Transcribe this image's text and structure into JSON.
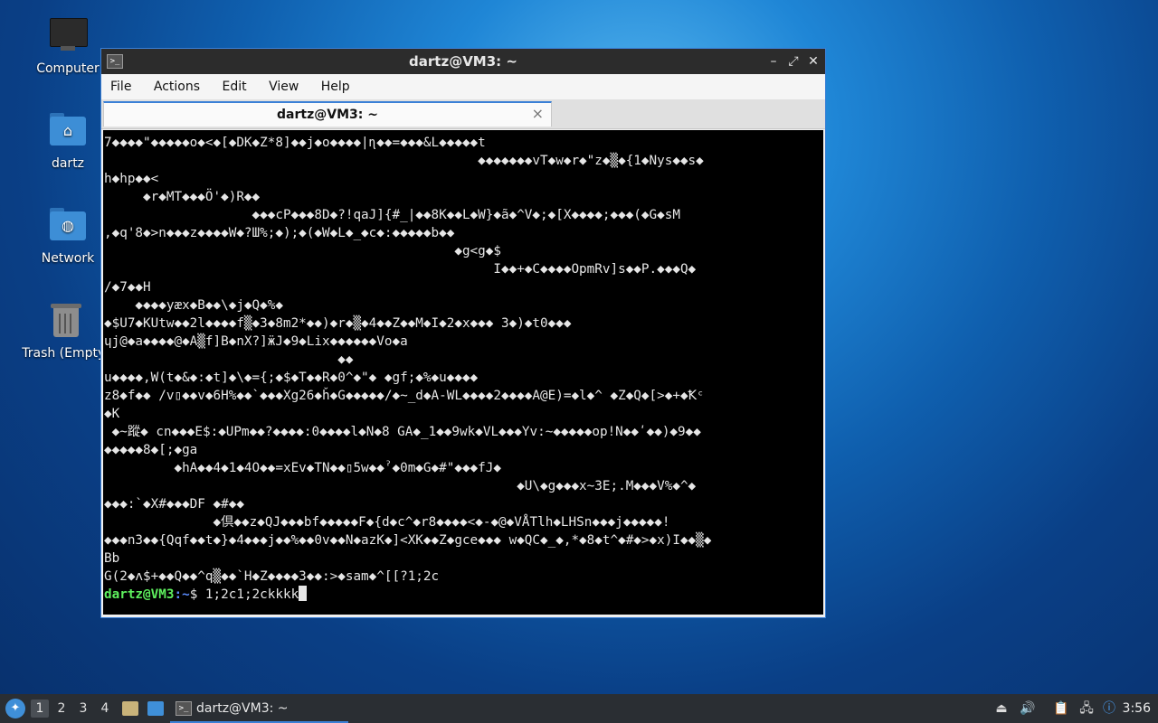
{
  "desktop": {
    "icons": [
      {
        "label": "Computer"
      },
      {
        "label": "dartz"
      },
      {
        "label": "Network"
      },
      {
        "label": "Trash (Empty)"
      }
    ]
  },
  "window": {
    "title": "dartz@VM3: ~",
    "buttons": {
      "minimize": "–",
      "maximize": "⤢",
      "close": "✕"
    },
    "menu": [
      "File",
      "Actions",
      "Edit",
      "View",
      "Help"
    ],
    "tab": {
      "label": "dartz@VM3: ~",
      "close": "×"
    }
  },
  "terminal": {
    "lines": [
      "7◆◆◆◆\"◆◆◆◆◆o◆<◆[◆DK◆Z*8]◆◆j◆o◆◆◆◆|ɳ◆◆=◆◆◆&L◆◆◆◆◆t",
      "                                                ◆◆◆◆◆◆◆vT◆w◆r◆\"z◆▒◆{1◆Nys◆◆s◆",
      "h◆hp◆◆<",
      "     ◆r◆MT◆◆◆Ö'◆)R◆◆",
      "                   ◆◆◆cP◆◆◆8D◆?!qaJ]{#_|◆◆8K◆◆L◆W}◆ã◆^V◆;◆[X◆◆◆◆;◆◆◆(◆G◆sM",
      ",◆q'8◆>n◆◆◆z◆◆◆◆W◆?Ш%;◆);◆(◆W◆L◆_◆c◆:◆◆◆◆◆b◆◆",
      "                                             ◆g<g◆$",
      "                                                  I◆◆+◆C◆◆◆◆OpmRv]s◆◆P.◆◆◆Q◆",
      "/◆7◆◆H",
      "    ◆◆◆◆yæx◆B◆◆\\◆j◆Q◆%◆",
      "◆$U7◆KUtw◆◆2l◆◆◆◆f▒◆3◆8m2*◆◆)◆r◆▒◆4◆◆Z◆◆M◆I◆2◆x◆◆◆ 3◆)◆t0◆◆◆",
      "ɥj@◆a◆◆◆◆@◆A▒f]B◆nX?]ӝJ◆9◆Lix◆◆◆◆◆◆Vo◆a",
      "                              ◆◆",
      "u◆◆◆◆,W(t◆&◆:◆t]◆\\◆={;◆$◆T◆◆R◆0^◆\"◆ ◆gf;◆%◆u◆◆◆◆",
      "z8◆f◆◆ /v▯◆◆v◆6H%◆◆`◆◆◆Xg26◆ȟ◆G◆◆◆◆◆/◆~_d◆A-WL◆◆◆◆2◆◆◆◆A@E)=◆l◆^ ◆Z◆Q◆[>◆+◆Ꝁᶜ",
      "◆K",
      " ◆~蹤◆ cn◆◆◆E$:◆UPm◆◆?◆◆◆◆:0◆◆◆◆l◆N◆8 GA◆_1◆◆9wk◆VL◆◆◆Yv:~◆◆◆◆◆op!N◆◆ʹ◆◆)◆9◆◆",
      "◆◆◆◆◆8◆[;◆ga",
      "         ◆hA◆◆4◆1◆4O◆◆=xEv◆TN◆◆▯5w◆◆ˀ◆0m◆G◆#\"◆◆◆fJ◆",
      "                                                     ◆U\\◆g◆◆◆x~3E;.M◆◆◆V%◆^◆",
      "◆◆◆:`◆X#◆◆◆DF ◆#◆◆",
      "              ◆倶◆◆z◆QJ◆◆◆bf◆◆◆◆◆F◆{d◆c^◆r8◆◆◆◆<◆-◆@◆VÅTlh◆LHSn◆◆◆j◆◆◆◆◆!",
      "◆◆◆n3◆◆{Qqf◆◆t◆}◆4◆◆◆j◆◆%◆◆0v◆◆N◆azK◆]<XK◆◆Z◆gce◆◆◆ w◆QC◆_◆,*◆8◆t^◆#◆>◆x)I◆◆▒◆",
      "Bb",
      "G(2◆ʌ$+◆◆Q◆◆^q▒◆◆`H◆Z◆◆◆◆3◆◆:>◆sam◆^[[?1;2c"
    ],
    "prompt_user": "dartz@VM3",
    "prompt_path": ":~",
    "prompt_symbol": "$ ",
    "command": "1;2c1;2ckkkk"
  },
  "taskbar": {
    "workspaces": [
      "1",
      "2",
      "3",
      "4"
    ],
    "active_workspace": "1",
    "task_label": "dartz@VM3: ~",
    "clock": "3:56"
  }
}
